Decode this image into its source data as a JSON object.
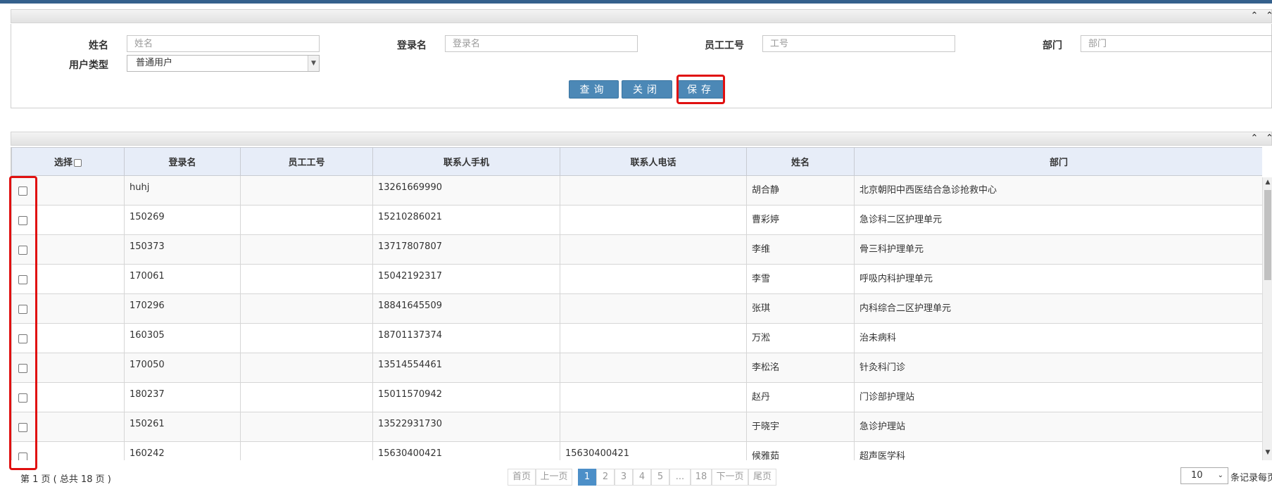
{
  "search": {
    "fields": [
      {
        "label": "姓名",
        "placeholder": "姓名"
      },
      {
        "label": "登录名",
        "placeholder": "登录名"
      },
      {
        "label": "员工工号",
        "placeholder": "工号"
      },
      {
        "label": "部门",
        "placeholder": "部门"
      }
    ],
    "user_type_label": "用户类型",
    "user_type_value": "普通用户",
    "buttons": {
      "query": "查询",
      "close": "关闭",
      "save": "保存"
    }
  },
  "grid": {
    "columns": [
      "选择",
      "登录名",
      "员工工号",
      "联系人手机",
      "联系人电话",
      "姓名",
      "部门"
    ],
    "rows": [
      [
        "huhj",
        "",
        "13261669990",
        "",
        "胡合静",
        "北京朝阳中西医结合急诊抢救中心"
      ],
      [
        "150269",
        "",
        "15210286021",
        "",
        "曹彩婷",
        "急诊科二区护理单元"
      ],
      [
        "150373",
        "",
        "13717807807",
        "",
        "李维",
        "骨三科护理单元"
      ],
      [
        "170061",
        "",
        "15042192317",
        "",
        "李雪",
        "呼吸内科护理单元"
      ],
      [
        "170296",
        "",
        "18841645509",
        "",
        "张琪",
        "内科综合二区护理单元"
      ],
      [
        "160305",
        "",
        "18701137374",
        "",
        "万淞",
        "治未病科"
      ],
      [
        "170050",
        "",
        "13514554461",
        "",
        "李松洺",
        "针灸科门诊"
      ],
      [
        "180237",
        "",
        "15011570942",
        "",
        "赵丹",
        "门诊部护理站"
      ],
      [
        "150261",
        "",
        "13522931730",
        "",
        "于晓宇",
        "急诊护理站"
      ],
      [
        "160242",
        "",
        "15630400421",
        "15630400421",
        "候雅茹",
        "超声医学科"
      ]
    ]
  },
  "pager": {
    "info": "第 1 页 ( 总共 18 页 )",
    "first": "首页",
    "prev": "上一页",
    "pages": [
      "1",
      "2",
      "3",
      "4",
      "5",
      "...",
      "18"
    ],
    "next": "下一页",
    "last": "尾页",
    "page_size": "10",
    "page_size_label": "条记录每页"
  },
  "icons": {
    "collapse": "chevron-up-icon"
  },
  "colors": {
    "button": "#4c88b6",
    "active_page": "#4c8fc8",
    "highlight": "#e01010",
    "header": "#e7edf8"
  }
}
